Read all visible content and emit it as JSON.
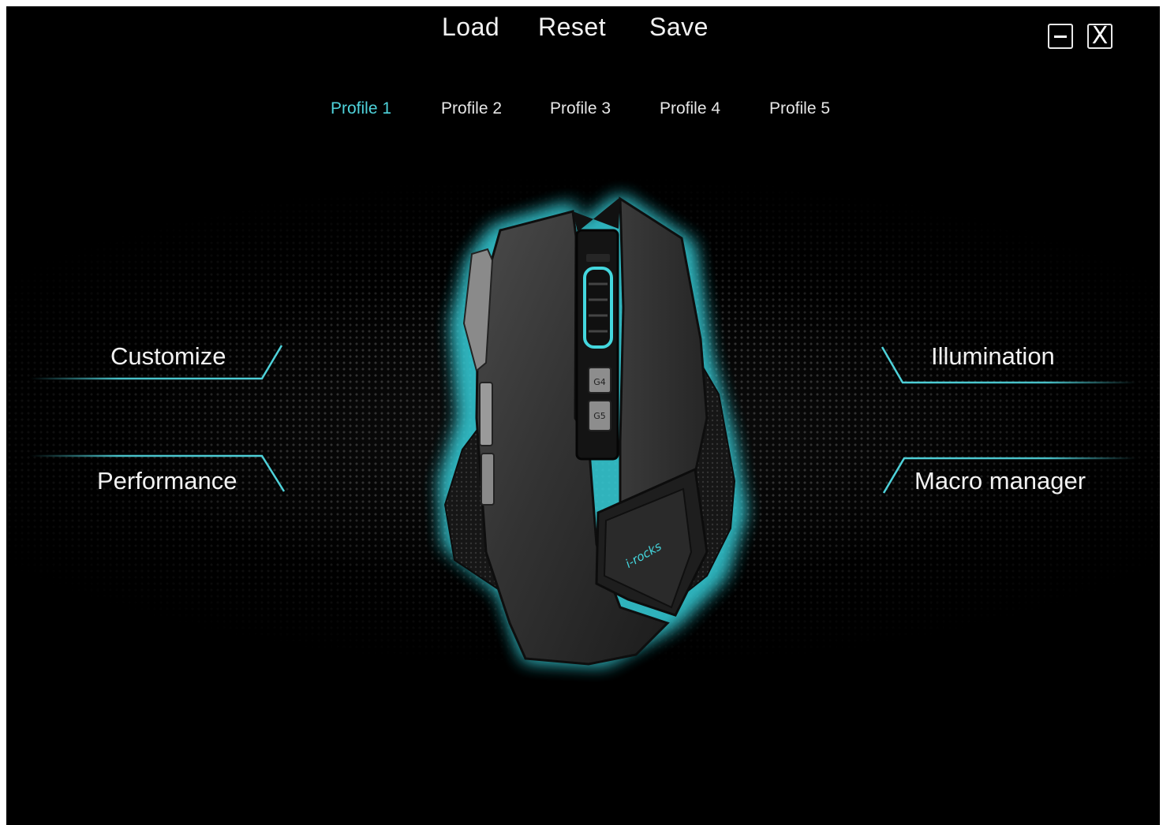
{
  "toolbar": {
    "load_label": "Load",
    "reset_label": "Reset",
    "save_label": "Save"
  },
  "window_controls": {
    "minimize_icon": "minimize-icon",
    "close_icon": "close-icon",
    "close_glyph": "X"
  },
  "profiles": {
    "tabs": [
      {
        "label": "Profile 1",
        "active": true
      },
      {
        "label": "Profile 2",
        "active": false
      },
      {
        "label": "Profile 3",
        "active": false
      },
      {
        "label": "Profile 4",
        "active": false
      },
      {
        "label": "Profile 5",
        "active": false
      }
    ]
  },
  "nav": {
    "customize": "Customize",
    "performance": "Performance",
    "illumination": "Illumination",
    "macro_manager": "Macro manager"
  },
  "mouse": {
    "button_g4": "G4",
    "button_g5": "G5",
    "brand_logo": "i-rocks"
  },
  "colors": {
    "accent": "#4fd3db",
    "glow": "#2fb8c4",
    "background": "#000000"
  }
}
